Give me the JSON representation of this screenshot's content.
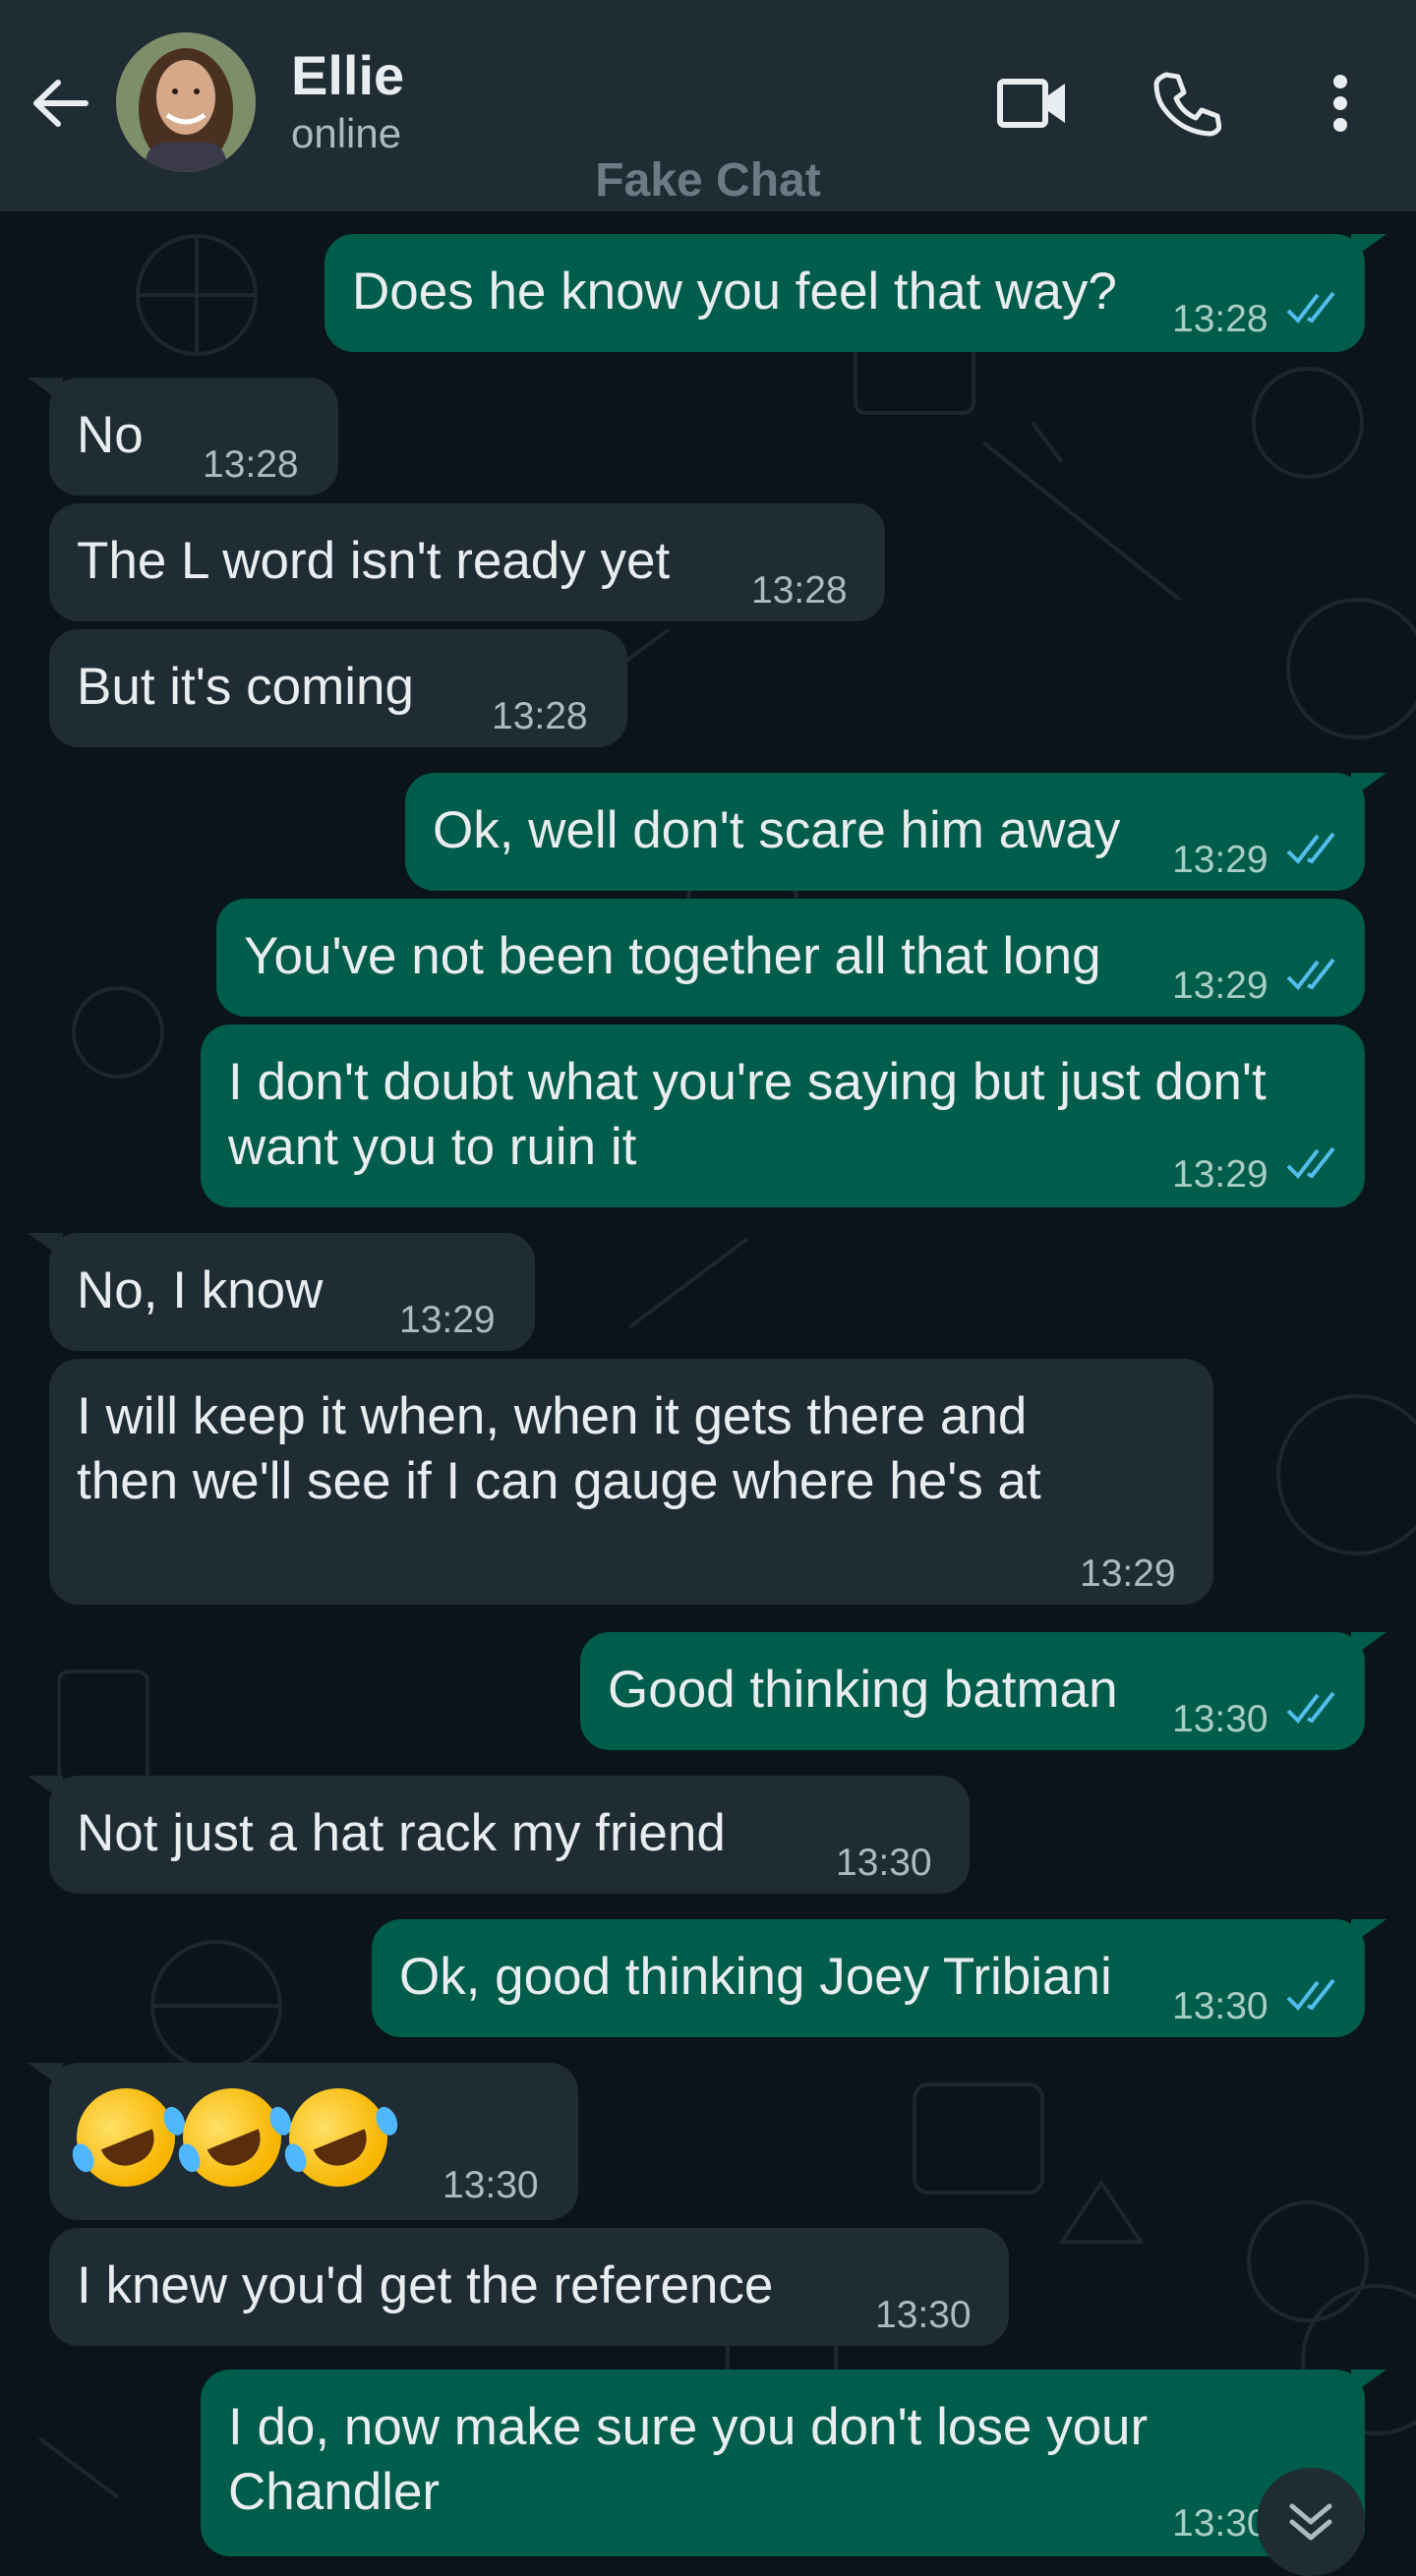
{
  "header": {
    "contact_name": "Ellie",
    "status": "online",
    "watermark": "Fake Chat",
    "icons": [
      "back-arrow-icon",
      "video-call-icon",
      "phone-icon",
      "more-vertical-icon"
    ]
  },
  "colors": {
    "background": "#0b141a",
    "header": "#1f2c34",
    "incoming_bubble": "#1f2c34",
    "outgoing_bubble": "#005c4b",
    "read_ticks": "#53bdeb"
  },
  "messages": [
    {
      "dir": "out",
      "text": "Does he know you feel that way?",
      "time": "13:28",
      "read": true
    },
    {
      "dir": "in",
      "text": "No",
      "time": "13:28"
    },
    {
      "dir": "in",
      "text": "The L word isn't ready yet",
      "time": "13:28"
    },
    {
      "dir": "in",
      "text": "But it's coming",
      "time": "13:28"
    },
    {
      "dir": "out",
      "text": "Ok, well don't scare him away",
      "time": "13:29",
      "read": true
    },
    {
      "dir": "out",
      "text": "You've not been together all that long",
      "time": "13:29",
      "read": true
    },
    {
      "dir": "out",
      "text": "I don't doubt what you're saying but just don't\nwant you to ruin it",
      "time": "13:29",
      "read": true
    },
    {
      "dir": "in",
      "text": "No, I know",
      "time": "13:29"
    },
    {
      "dir": "in",
      "text": "I will keep it when, when it gets there and\nthen we'll see if I can gauge where he's at",
      "time": "13:29"
    },
    {
      "dir": "out",
      "text": "Good thinking batman",
      "time": "13:30",
      "read": true
    },
    {
      "dir": "in",
      "text": "Not just a hat rack my friend",
      "time": "13:30"
    },
    {
      "dir": "out",
      "text": "Ok, good thinking Joey Tribiani",
      "time": "13:30",
      "read": true
    },
    {
      "dir": "in",
      "text": "🤣🤣🤣",
      "emoji": "rolling-on-the-floor-laughing",
      "count": 3,
      "time": "13:30"
    },
    {
      "dir": "in",
      "text": "I knew you'd get the reference",
      "time": "13:30"
    },
    {
      "dir": "out",
      "text": "I do, now make sure you don't lose your\nChandler",
      "time": "13:30",
      "read": true
    }
  ]
}
